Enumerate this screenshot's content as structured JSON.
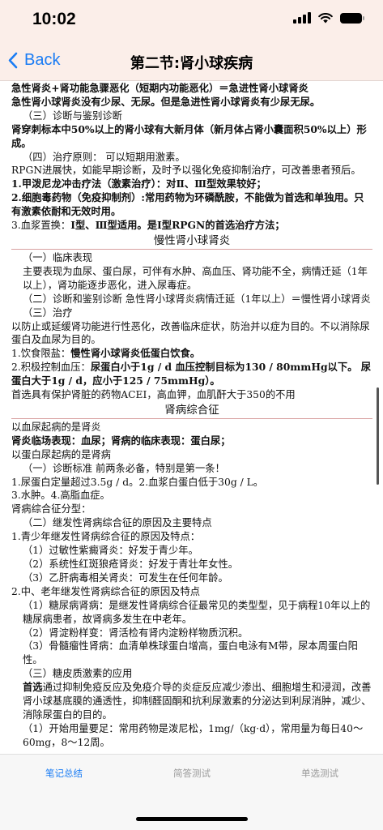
{
  "status": {
    "time": "10:02"
  },
  "nav": {
    "back_label": "Back",
    "title": "第二节:肾小球疾病"
  },
  "content": {
    "l1": "急性肾炎+肾功能急骤恶化（短期内功能恶化）＝急进性肾小球肾炎",
    "l2": "急性肾小球肾炎没有少尿、无尿。但是急进性肾小球肾炎有少尿无尿。",
    "l3": "（三）诊断与鉴别诊断",
    "l4": "肾穿刺标本中50%以上的肾小球有大新月体（新月体占肾小囊面积50%以上）形成。",
    "l5": "（四）治疗原则： 可以短期用激素。",
    "l6": "RPGN进展快，如能早期诊断，及时予以强化免疫抑制治疗，可改善患者预后。",
    "l7": "1.甲泼尼龙冲击疗法（激素治疗）：对Ⅱ、Ⅲ型效果较好；",
    "l8": "2.细胞毒药物（免疫抑制剂）:常用药物为环磷酰胺，不能做为首选和单独用。只有激素依耐和无效时用。",
    "l9a": "3.血浆置换：",
    "l9b": "Ⅰ型、Ⅲ型适用。是Ⅰ型RPGN的首选治疗方法；",
    "sec1": "慢性肾小球肾炎",
    "m1": "（一）临床表现",
    "m2": "主要表现为血尿、蛋白尿，可伴有水肿、高血压、肾功能不全，病情迁延（1年以上），肾功能逐步恶化，进入尿毒症。",
    "m3": "（二）诊断和鉴别诊断 急性肾小球肾炎病情迁延（1年以上）＝慢性肾小球肾炎",
    "m4": "（三）治疗",
    "m5": "以防止或延缓肾功能进行性恶化，改善临床症状，防治并以症为目的。不以消除尿蛋白及血尿为目的。",
    "m6a": "1.饮食限盐：",
    "m6b": "慢性肾小球肾炎低蛋白饮食。",
    "m7a": "2.积极控制血压：",
    "m7b": "尿蛋白小于1g / d 血压控制目标为130 / 80mmHg以下。  尿蛋白大于1g / d，应小于125 / 75mmHg）。",
    "m8": "首选具有保护肾脏的药物ACEI，高血钾，血肌酐大于350的不用",
    "sec2": "肾病综合征",
    "n1": "以血尿起病的是肾炎",
    "n2": "肾炎临场表现：血尿；肾病的临床表现：蛋白尿；",
    "n3": "以蛋白尿起病的是肾病",
    "n4": "（一）诊断标准 前两条必备，特别是第一条！",
    "n5": "1.尿蛋白定量超过3.5g / d。2.血浆白蛋白低于30g / L。",
    "n6": "3.水肿。4.高脂血症。",
    "n7": "肾病综合征分型：",
    "n8": "（二）继发性肾病综合征的原因及主要特点",
    "n9": "1.青少年继发性肾病综合征的原因及特点：",
    "n10": "（1）过敏性紫癜肾炎：好发于青少年。",
    "n11": "（2）系统性红斑狼疮肾炎：好发于青壮年女性。",
    "n12": "（3）乙肝病毒相关肾炎：可发生在任何年龄。",
    "n13": "2.中、老年继发性肾病综合征的原因及特点",
    "n14": "（1）糖尿病肾病：是继发性肾病综合征最常见的类型型，见于病程10年以上的糖尿病患者，故肾病多发生在中老年。",
    "n15": "（2）肾淀粉样变：肾活检有肾内淀粉样物质沉积。",
    "n16": "（3）骨髓瘤性肾病：血清单株球蛋白增高，蛋白电泳有M带，尿本周蛋白阳性。",
    "n17": "（三）糖皮质激素的应用",
    "n18a": "首选",
    "n18b": "通过抑制免疫反应及免疫介导的炎症反应减少渗出、细胞增生和浸润，改善肾小球基底膜的通透性，抑制醛固酮和抗利尿激素的分泌达到利尿消肿，减少、消除尿蛋白的目的。",
    "n19": "（1）开始用量要足：常用药物是泼尼松，1mg/（kg·d），常用量为每日40～60mg，8～12周。"
  },
  "tabs": [
    {
      "label": "笔记总结",
      "active": true
    },
    {
      "label": "简答测试",
      "active": false
    },
    {
      "label": "单选测试",
      "active": false
    }
  ],
  "colors": {
    "accent": "#1a7cf4",
    "header_bg": "#fbeee9",
    "inactive_tab": "#9a9a9a"
  }
}
